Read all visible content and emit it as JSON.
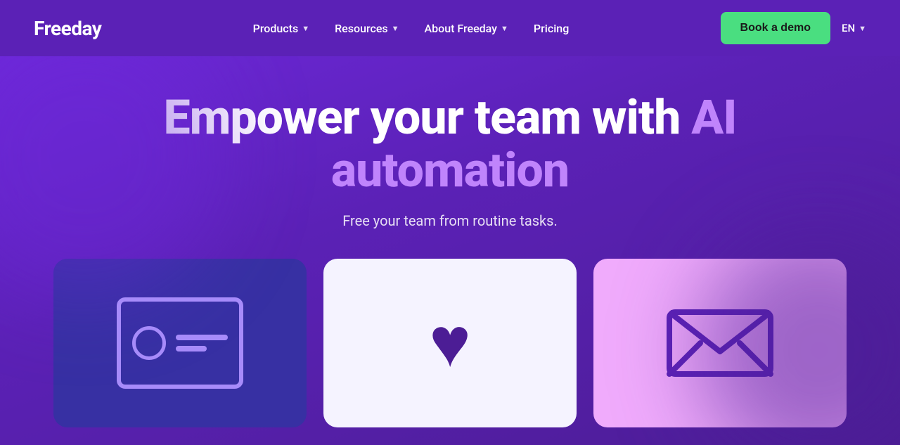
{
  "brand": {
    "name": "Freeday",
    "logo_text": "Freeday"
  },
  "nav": {
    "items": [
      {
        "label": "Products",
        "has_dropdown": true
      },
      {
        "label": "Resources",
        "has_dropdown": true
      },
      {
        "label": "About Freeday",
        "has_dropdown": true
      },
      {
        "label": "Pricing",
        "has_dropdown": false
      }
    ],
    "cta_label": "Book a demo",
    "lang_label": "EN"
  },
  "hero": {
    "headline_part1": "Empower your team with ",
    "headline_ai": "AI",
    "headline_part2": "automation",
    "subtitle": "Free your team from routine tasks."
  },
  "cards": [
    {
      "id": "card-left",
      "icon_type": "id-card",
      "bg": "#3730a3"
    },
    {
      "id": "card-middle",
      "icon_type": "heart",
      "bg": "#f5f3ff"
    },
    {
      "id": "card-right",
      "icon_type": "envelope",
      "bg": "#f0abfc"
    }
  ]
}
